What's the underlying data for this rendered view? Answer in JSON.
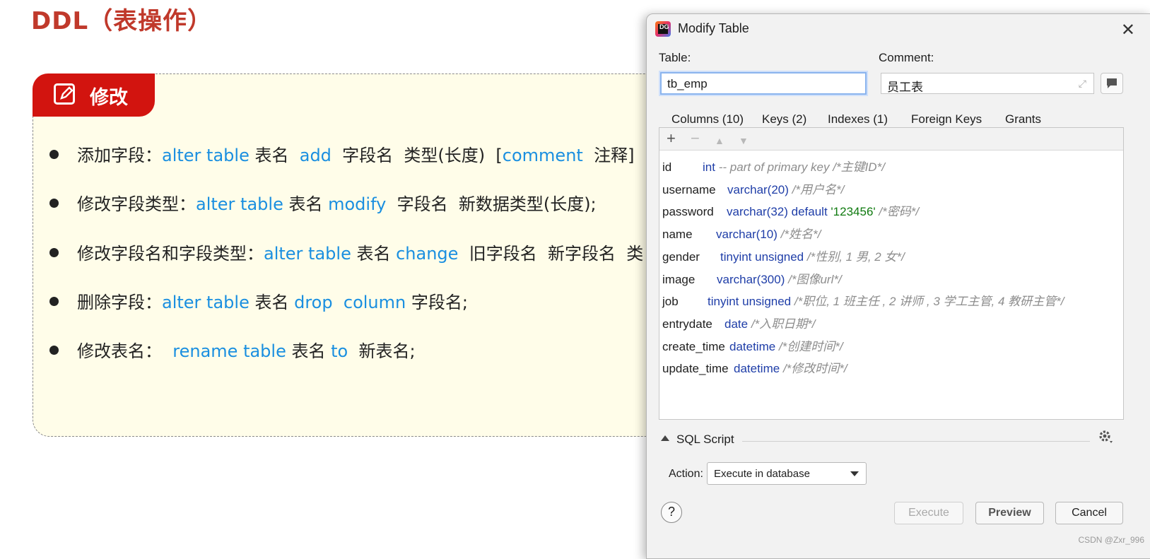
{
  "slide": {
    "title": "DDL（表操作）",
    "card_header": "修改",
    "items": [
      {
        "parts": [
          [
            "添加字段：",
            ""
          ],
          [
            "alter table",
            "kw"
          ],
          [
            " 表名  ",
            ""
          ],
          [
            "add",
            "kw"
          ],
          [
            "  字段名  类型(长度)  [",
            ""
          ],
          [
            "comment",
            "kw"
          ],
          [
            "  注释]",
            ""
          ]
        ]
      },
      {
        "parts": [
          [
            "修改字段类型：",
            ""
          ],
          [
            "alter table",
            "kw"
          ],
          [
            " 表名 ",
            ""
          ],
          [
            "modify",
            "kw"
          ],
          [
            "  字段名  新数据类型(长度);",
            ""
          ]
        ]
      },
      {
        "parts": [
          [
            "修改字段名和字段类型：",
            ""
          ],
          [
            "alter table",
            "kw"
          ],
          [
            " 表名 ",
            ""
          ],
          [
            "change",
            "kw"
          ],
          [
            "  旧字段名  新字段名  类",
            ""
          ]
        ]
      },
      {
        "parts": [
          [
            "删除字段：",
            ""
          ],
          [
            "alter table",
            "kw"
          ],
          [
            " 表名 ",
            ""
          ],
          [
            "drop",
            "kw"
          ],
          [
            "  ",
            ""
          ],
          [
            "column",
            "kw"
          ],
          [
            " 字段名;",
            ""
          ]
        ]
      },
      {
        "parts": [
          [
            "修改表名：  ",
            ""
          ],
          [
            "rename table",
            "kw"
          ],
          [
            " 表名 ",
            ""
          ],
          [
            "to",
            "kw"
          ],
          [
            "  新表名;",
            ""
          ]
        ]
      }
    ]
  },
  "dialog": {
    "title": "Modify Table",
    "close_icon": "close-icon",
    "table_label": "Table:",
    "table_value": "tb_emp",
    "comment_label": "Comment:",
    "comment_value": "员工表",
    "tabs": [
      "Columns (10)",
      "Keys (2)",
      "Indexes (1)",
      "Foreign Keys",
      "Grants"
    ],
    "active_tab": 0,
    "toolbar": [
      "+",
      "−",
      "▲",
      "▼"
    ],
    "columns": [
      {
        "name": "id",
        "type": "int",
        "extra": "",
        "comment": "-- part of primary key /*主键ID*/"
      },
      {
        "name": "username",
        "type": "varchar(20)",
        "extra": "",
        "comment": "/*用户名*/"
      },
      {
        "name": "password",
        "type": "varchar(32) default",
        "extra": "'123456'",
        "comment": "/*密码*/"
      },
      {
        "name": "name",
        "type": "varchar(10)",
        "extra": "",
        "comment": "/*姓名*/"
      },
      {
        "name": "gender",
        "type": "tinyint unsigned",
        "extra": "",
        "comment": "/*性别, 1 男, 2 女*/"
      },
      {
        "name": "image",
        "type": "varchar(300)",
        "extra": "",
        "comment": "/*图像url*/"
      },
      {
        "name": "job",
        "type": "tinyint unsigned",
        "extra": "",
        "comment": "/*职位, 1 班主任 , 2 讲师 , 3 学工主管, 4 教研主管*/"
      },
      {
        "name": "entrydate",
        "type": "date",
        "extra": "",
        "comment": "/*入职日期*/"
      },
      {
        "name": "create_time",
        "type": "datetime",
        "extra": "",
        "comment": "/*创建时间*/"
      },
      {
        "name": "update_time",
        "type": "datetime",
        "extra": "",
        "comment": "/*修改时间*/"
      }
    ],
    "sql_script_label": "SQL Script",
    "action_label": "Action:",
    "action_value": "Execute in database",
    "help_label": "?",
    "execute_label": "Execute",
    "preview_label": "Preview",
    "cancel_label": "Cancel"
  },
  "watermark": "CSDN @Zxr_996"
}
